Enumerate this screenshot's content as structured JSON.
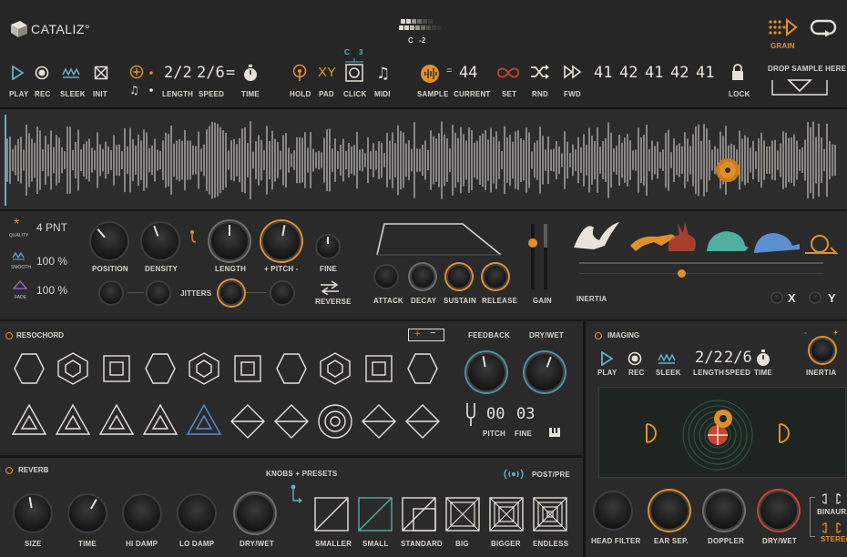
{
  "header": {
    "logo": "CATALIZ°",
    "note": "C",
    "octave": "-2",
    "note_top": "C",
    "note_top2": "3",
    "grain_label": "GRAIN",
    "controls": [
      {
        "label": "PLAY"
      },
      {
        "label": "REC"
      },
      {
        "label": "SLEEK"
      },
      {
        "label": "INIT"
      },
      {
        "label": "LENGTH",
        "value": "2/2"
      },
      {
        "label": "SPEED",
        "value": "2/6"
      },
      {
        "label": "TIME"
      },
      {
        "label": "HOLD"
      },
      {
        "label": "PAD",
        "glyph": "XY"
      },
      {
        "label": "CLICK"
      },
      {
        "label": "MIDI"
      },
      {
        "label": "SAMPLE"
      },
      {
        "label": "CURRENT",
        "value": "44"
      },
      {
        "label": "SET"
      },
      {
        "label": "RND"
      },
      {
        "label": "FWD"
      },
      {
        "label": "LOCK"
      }
    ],
    "sequence": [
      "41",
      "42",
      "41",
      "42",
      "41"
    ],
    "drop_label": "DROP SAMPLE HERE"
  },
  "grain": {
    "quality": {
      "label": "QUALITY",
      "value": "4 PNT"
    },
    "smooth": {
      "label": "SMOOTH",
      "value": "100 %"
    },
    "fade": {
      "label": "FADE",
      "value": "100 %"
    },
    "knobs": [
      "POSITION",
      "DENSITY",
      "LENGTH",
      "+ PITCH -",
      "FINE"
    ],
    "jitters": "JITTERS",
    "reverse": "REVERSE",
    "env": [
      "ATTACK",
      "DECAY",
      "SUSTAIN",
      "RELEASE"
    ],
    "gain": "GAIN",
    "inertia": "INERTIA",
    "x": "X",
    "y": "Y"
  },
  "resochord": {
    "title": "RESOCHORD",
    "plus": "+",
    "minus": "−",
    "feedback": "FEEDBACK",
    "drywet": "DRY/WET",
    "pitch_label": "PITCH",
    "pitch_value": "00",
    "fine_label": "FINE",
    "fine_value": "03"
  },
  "imaging": {
    "title": "IMAGING",
    "controls": [
      {
        "label": "PLAY"
      },
      {
        "label": "REC"
      },
      {
        "label": "SLEEK"
      },
      {
        "label": "LENGTH",
        "value": "2/2"
      },
      {
        "label": "SPEED",
        "value": "2/6"
      },
      {
        "label": "TIME"
      }
    ],
    "inertia": "INERTIA",
    "minus": "-",
    "plus": "+",
    "knobs": [
      "HEAD FILTER",
      "EAR SEP.",
      "DOPPLER",
      "DRY/WET"
    ],
    "binaural": "BINAURAL",
    "stereo": "STEREO"
  },
  "reverb": {
    "title": "REVERB",
    "presets_label": "KNOBS + PRESETS",
    "postpre": "POST/PRE",
    "knobs": [
      "SIZE",
      "TIME",
      "HI DAMP",
      "LO DAMP",
      "DRY/WET"
    ],
    "presets": [
      "SMALLER",
      "SMALL",
      "STANDARD",
      "BIG",
      "BIGGER",
      "ENDLESS"
    ]
  },
  "colors": {
    "accent": "#e0902a",
    "teal": "#4f8fa6",
    "red": "#c8452e",
    "purple": "#9b6bd0"
  }
}
